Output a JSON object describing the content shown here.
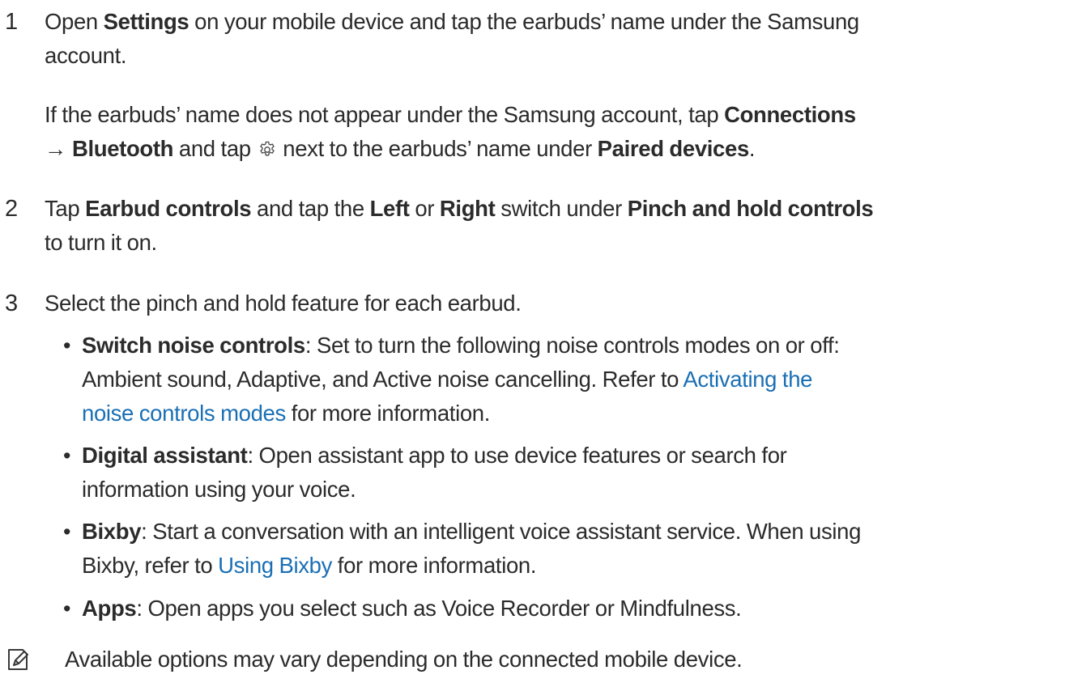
{
  "steps": [
    {
      "number": "1",
      "lines": {
        "a_pre": "Open ",
        "a_bold": "Settings",
        "a_post": " on your mobile device and tap the earbuds’ name under the Samsung",
        "b": "account.",
        "c_pre": "If the earbuds’ name does not appear under the Samsung account, tap ",
        "c_bold": "Connections",
        "d_arrow": "→ ",
        "d_bold1": "Bluetooth",
        "d_mid1": " and tap ",
        "d_mid2": " next to the earbuds’ name under ",
        "d_bold2": "Paired devices",
        "d_end": "."
      }
    },
    {
      "number": "2",
      "lines": {
        "a_pre": "Tap ",
        "a_bold1": "Earbud controls",
        "a_mid1": " and tap the ",
        "a_bold2": "Left",
        "a_mid2": " or ",
        "a_bold3": "Right",
        "a_mid3": " switch under ",
        "a_bold4": "Pinch and hold controls",
        "b": "to turn it on."
      }
    },
    {
      "number": "3",
      "lines": {
        "a": "Select the pinch and hold feature for each earbud."
      }
    }
  ],
  "bullets": [
    {
      "dot": "•",
      "bold": "Switch noise controls",
      "line1": ": Set to turn the following noise controls modes on or off:",
      "line2_pre": "Ambient sound, Adaptive, and Active noise cancelling. Refer to ",
      "line2_link": "Activating the",
      "line3_link": "noise controls modes",
      "line3_post": " for more information."
    },
    {
      "dot": "•",
      "bold": "Digital assistant",
      "line1": ": Open assistant app to use device features or search for",
      "line2": "information using your voice."
    },
    {
      "dot": "•",
      "bold": "Bixby",
      "line1": ": Start a conversation with an intelligent voice assistant service. When using",
      "line2_pre": "Bixby, refer to ",
      "line2_link": "Using Bixby",
      "line2_post": " for more information."
    },
    {
      "dot": "•",
      "bold": "Apps",
      "line1": ": Open apps you select such as Voice Recorder or Mindfulness."
    }
  ],
  "note": {
    "icon": "note-pencil-icon",
    "text": "Available options may vary depending on the connected mobile device."
  },
  "colors": {
    "text": "#2b2b2b",
    "link": "#1a6fb4"
  },
  "icons": {
    "inline_gear": "gear-icon"
  }
}
